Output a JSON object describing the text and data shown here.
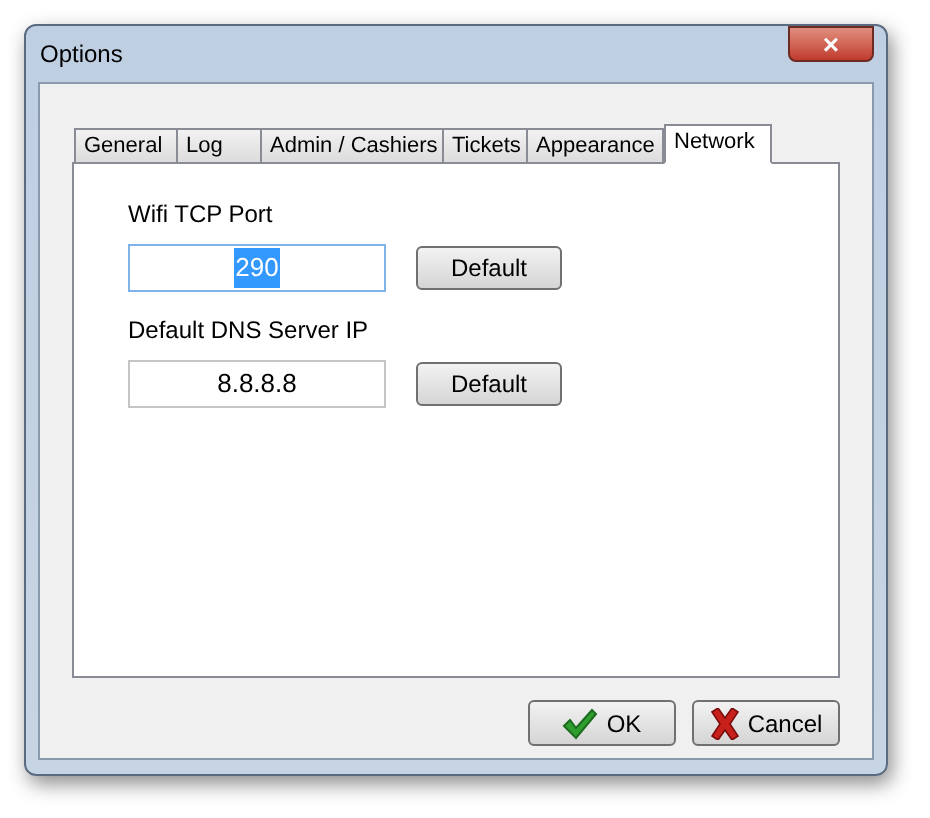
{
  "window": {
    "title": "Options",
    "close": "×"
  },
  "tabs": [
    {
      "label": "General",
      "selected": false
    },
    {
      "label": "Log",
      "selected": false
    },
    {
      "label": "Admin / Cashiers",
      "selected": false
    },
    {
      "label": "Tickets",
      "selected": false
    },
    {
      "label": "Appearance",
      "selected": false
    },
    {
      "label": "Network",
      "selected": true
    }
  ],
  "fields": [
    {
      "label": "Wifi TCP Port",
      "value": "290",
      "focused": true,
      "button": "Default"
    },
    {
      "label": "Default DNS Server IP",
      "value": "8.8.8.8",
      "focused": false,
      "button": "Default"
    }
  ],
  "buttons": [
    {
      "kind": "ok",
      "label": "OK"
    },
    {
      "kind": "cancel",
      "label": "Cancel"
    }
  ]
}
